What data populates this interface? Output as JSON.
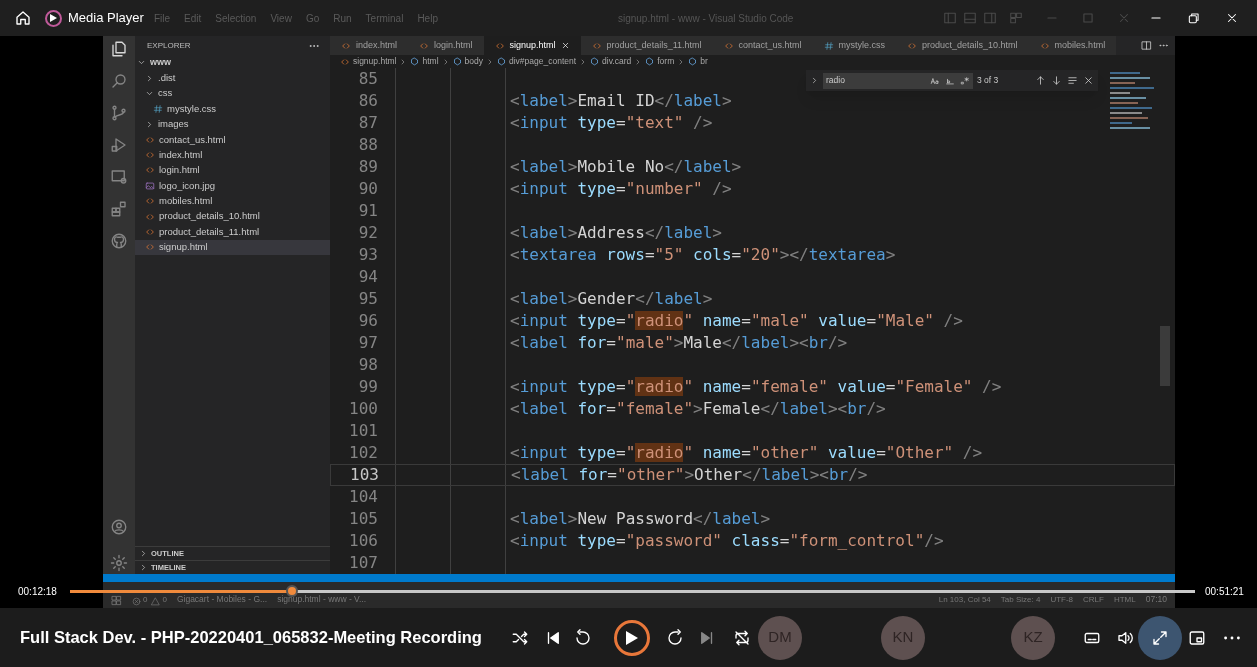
{
  "player": {
    "title": "Media Player",
    "video_title": "Full Stack Dev. - PHP-20220401_065832-Meeting Recording",
    "elapsed": "00:12:18",
    "duration": "00:51:21",
    "level": 0.197,
    "playing": false
  },
  "participants": [
    {
      "initials": "DM"
    },
    {
      "initials": "KN"
    },
    {
      "initials": "KZ"
    }
  ],
  "vscode": {
    "menu": [
      "File",
      "Edit",
      "Selection",
      "View",
      "Go",
      "Run",
      "Terminal",
      "Help"
    ],
    "window_title": "signup.html - www - Visual Studio Code",
    "explorer": {
      "title": "EXPLORER",
      "root": {
        "label": "www",
        "kind": "folder",
        "expanded": true,
        "selected": false,
        "children": [
          {
            "label": ".dist",
            "kind": "folder",
            "expanded": false,
            "selected": false
          },
          {
            "label": "css",
            "kind": "folder",
            "expanded": true,
            "selected": false,
            "children": [
              {
                "label": "mystyle.css",
                "kind": "css",
                "selected": false
              }
            ]
          },
          {
            "label": "images",
            "kind": "folder",
            "expanded": false,
            "selected": false
          },
          {
            "label": "contact_us.html",
            "kind": "html",
            "selected": false
          },
          {
            "label": "index.html",
            "kind": "html",
            "selected": false
          },
          {
            "label": "login.html",
            "kind": "html",
            "selected": false
          },
          {
            "label": "logo_icon.jpg",
            "kind": "image",
            "selected": false
          },
          {
            "label": "mobiles.html",
            "kind": "html",
            "selected": false
          },
          {
            "label": "product_details_10.html",
            "kind": "html",
            "selected": false
          },
          {
            "label": "product_details_11.html",
            "kind": "html",
            "selected": false
          },
          {
            "label": "signup.html",
            "kind": "html",
            "selected": true
          }
        ]
      },
      "sections": [
        {
          "label": "OUTLINE",
          "expanded": false
        },
        {
          "label": "TIMELINE",
          "expanded": false
        }
      ]
    },
    "tabs": [
      {
        "label": "index.html",
        "kind": "html",
        "selected": false
      },
      {
        "label": "login.html",
        "kind": "html",
        "selected": false
      },
      {
        "label": "signup.html",
        "kind": "html",
        "selected": true
      },
      {
        "label": "product_details_11.html",
        "kind": "html",
        "selected": false
      },
      {
        "label": "contact_us.html",
        "kind": "html",
        "selected": false
      },
      {
        "label": "mystyle.css",
        "kind": "css",
        "selected": false
      },
      {
        "label": "product_details_10.html",
        "kind": "html",
        "selected": false
      },
      {
        "label": "mobiles.html",
        "kind": "html",
        "selected": false
      }
    ],
    "breadcrumb": [
      "signup.html",
      "html",
      "body",
      "div#page_content",
      "div.card",
      "form",
      "br"
    ],
    "find": {
      "query": "radio",
      "count": "3 of 3"
    },
    "lines": [
      {
        "number": "85",
        "current": false
      },
      {
        "number": "86",
        "code": "<label>Email ID</label>",
        "current": false
      },
      {
        "number": "87",
        "code": "<input type=\"text\" />",
        "current": false
      },
      {
        "number": "88",
        "current": false
      },
      {
        "number": "89",
        "code": "<label>Mobile No</label>",
        "current": false
      },
      {
        "number": "90",
        "code": "<input type=\"number\" />",
        "current": false
      },
      {
        "number": "91",
        "current": false
      },
      {
        "number": "92",
        "code": "<label>Address</label>",
        "current": false
      },
      {
        "number": "93",
        "code": "<textarea rows=\"5\" cols=\"20\"></textarea>",
        "current": false
      },
      {
        "number": "94",
        "current": false
      },
      {
        "number": "95",
        "code": "<label>Gender</label>",
        "current": false
      },
      {
        "number": "96",
        "code": "<input type=\"radio\" name=\"male\" value=\"Male\" />",
        "current": false
      },
      {
        "number": "97",
        "code": "<label for=\"male\">Male</label><br/>",
        "current": false
      },
      {
        "number": "98",
        "current": false
      },
      {
        "number": "99",
        "code": "<input type=\"radio\" name=\"female\" value=\"Female\" />",
        "current": false
      },
      {
        "number": "100",
        "code": "<label for=\"female\">Female</label><br/>",
        "current": false
      },
      {
        "number": "101",
        "current": false
      },
      {
        "number": "102",
        "code": "<input type=\"radio\" name=\"other\" value=\"Other\" />",
        "current": false
      },
      {
        "number": "103",
        "code": "<label for=\"other\">Other</label><br/>",
        "current": true
      },
      {
        "number": "104",
        "current": false
      },
      {
        "number": "105",
        "code": "<label>New Password</label>",
        "current": false
      },
      {
        "number": "106",
        "code": "<input type=\"password\" class=\"form_control\"/>",
        "current": false
      },
      {
        "number": "107",
        "current": false
      }
    ],
    "status": {
      "errors": "0",
      "warnings": "0",
      "items": [
        "Ln 103, Col 54",
        "Tab Size: 4",
        "UTF-8",
        "CRLF",
        "HTML"
      ]
    },
    "taskbar": {
      "items": [
        "Gigacart - Mobiles - G...",
        "signup.html - www - V..."
      ],
      "time": "07:10"
    }
  }
}
